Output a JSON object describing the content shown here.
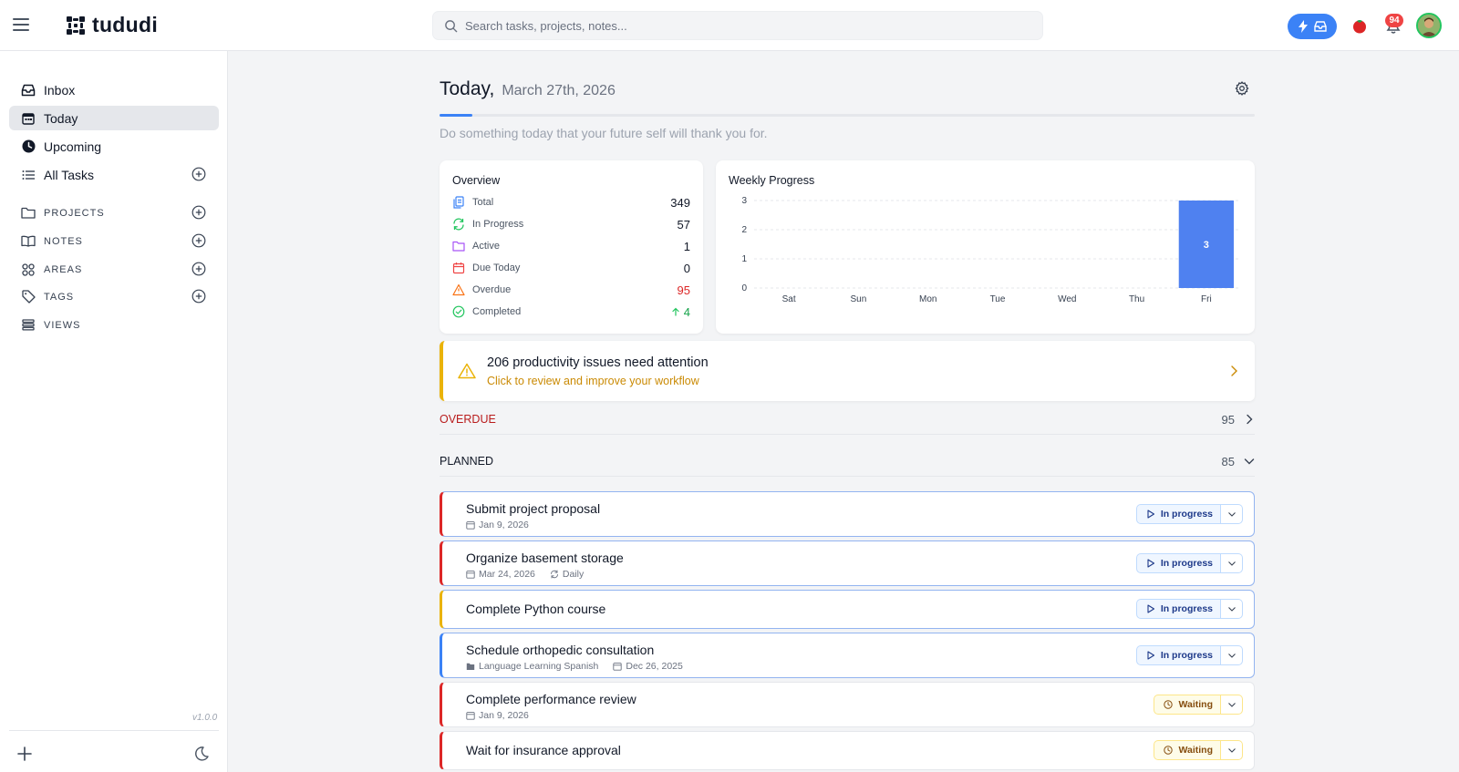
{
  "app": {
    "logo_text": "tududi",
    "search_placeholder": "Search tasks, projects, notes...",
    "notifications_count": "94"
  },
  "sidebar": {
    "nav": [
      {
        "label": "Inbox",
        "icon": "inbox-icon"
      },
      {
        "label": "Today",
        "icon": "calendar-icon"
      },
      {
        "label": "Upcoming",
        "icon": "clock-icon"
      },
      {
        "label": "All Tasks",
        "icon": "list-icon"
      }
    ],
    "sections": [
      {
        "label": "PROJECTS",
        "icon": "folder-icon"
      },
      {
        "label": "NOTES",
        "icon": "book-icon"
      },
      {
        "label": "AREAS",
        "icon": "grid-icon"
      },
      {
        "label": "TAGS",
        "icon": "tag-icon"
      },
      {
        "label": "VIEWS",
        "icon": "stack-icon"
      }
    ],
    "version": "v1.0.0"
  },
  "today": {
    "title": "Today,",
    "date": "March 27th, 2026",
    "progress_fraction": 0.04,
    "motto": "Do something today that your future self will thank you for."
  },
  "overview": {
    "title": "Overview",
    "rows": [
      {
        "label": "Total",
        "value": "349",
        "icon": "clipboard-icon",
        "color": "#3b82f6"
      },
      {
        "label": "In Progress",
        "value": "57",
        "icon": "refresh-icon",
        "color": "#22c55e"
      },
      {
        "label": "Active",
        "value": "1",
        "icon": "folder-icon",
        "color": "#a855f7"
      },
      {
        "label": "Due Today",
        "value": "0",
        "icon": "calendar-icon",
        "color": "#ef4444"
      },
      {
        "label": "Overdue",
        "value": "95",
        "icon": "warning-icon",
        "color": "#f97316"
      },
      {
        "label": "Completed",
        "value": "4",
        "icon": "check-circle-icon",
        "color": "#22c55e"
      }
    ]
  },
  "chart_data": {
    "type": "bar",
    "title": "Weekly Progress",
    "categories": [
      "Sat",
      "Sun",
      "Mon",
      "Tue",
      "Wed",
      "Thu",
      "Fri"
    ],
    "values": [
      0,
      0,
      0,
      0,
      0,
      0,
      3
    ],
    "ylim": [
      0,
      3
    ],
    "yticks": [
      "0",
      "1",
      "2",
      "3"
    ],
    "grid": true,
    "bar_color": "#4f81f0"
  },
  "alert": {
    "title": "206 productivity issues need attention",
    "subtitle": "Click to review and improve your workflow",
    "accent": "#eab308"
  },
  "sections": {
    "overdue": {
      "label": "OVERDUE",
      "count": "95",
      "color": "#b91c1c"
    },
    "planned": {
      "label": "PLANNED",
      "count": "85",
      "color": "#111827"
    }
  },
  "tasks": [
    {
      "title": "Submit project proposal",
      "date": "Jan 9, 2026",
      "status": "In progress",
      "priority_color": "#dc2626"
    },
    {
      "title": "Organize basement storage",
      "date": "Mar 24, 2026",
      "repeat": "Daily",
      "status": "In progress",
      "priority_color": "#dc2626"
    },
    {
      "title": "Complete Python course",
      "status": "In progress",
      "priority_color": "#eab308"
    },
    {
      "title": "Schedule orthopedic consultation",
      "project": "Language Learning Spanish",
      "date": "Dec 26, 2025",
      "status": "In progress",
      "priority_color": "#3b82f6"
    },
    {
      "title": "Complete performance review",
      "date": "Jan 9, 2026",
      "status": "Waiting",
      "priority_color": "#dc2626"
    },
    {
      "title": "Wait for insurance approval",
      "status": "Waiting",
      "priority_color": "#dc2626"
    }
  ]
}
